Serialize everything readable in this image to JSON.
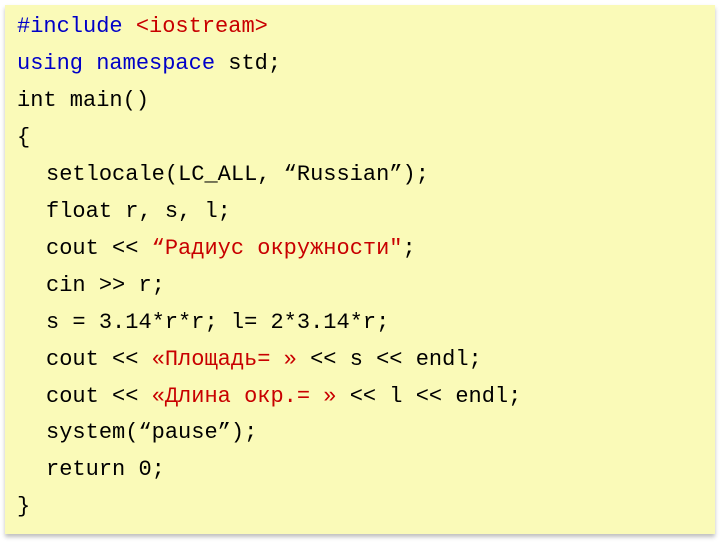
{
  "code": {
    "l1a": "#include ",
    "l1b": "<iostream>",
    "l2a": "using namespace",
    "l2b": " std;",
    "l3": "int main()",
    "l4": "{",
    "l5": "setlocale(LC_ALL, “Russian”);",
    "l6": "float r, s, l;",
    "l7a": "cout << ",
    "l7b": "“Радиус окружности\"",
    "l7c": ";",
    "l8": "cin >> r;",
    "l9": "s = 3.14*r*r; l= 2*3.14*r;",
    "l10a": "cout << ",
    "l10b": "«Площадь= »",
    "l10c": " << s << endl;",
    "l11a": "cout << ",
    "l11b": "«Длина окр.= »",
    "l11c": " << l << endl;",
    "l12": "system(“pause”);",
    "l13": "return 0;",
    "l14": "}"
  }
}
